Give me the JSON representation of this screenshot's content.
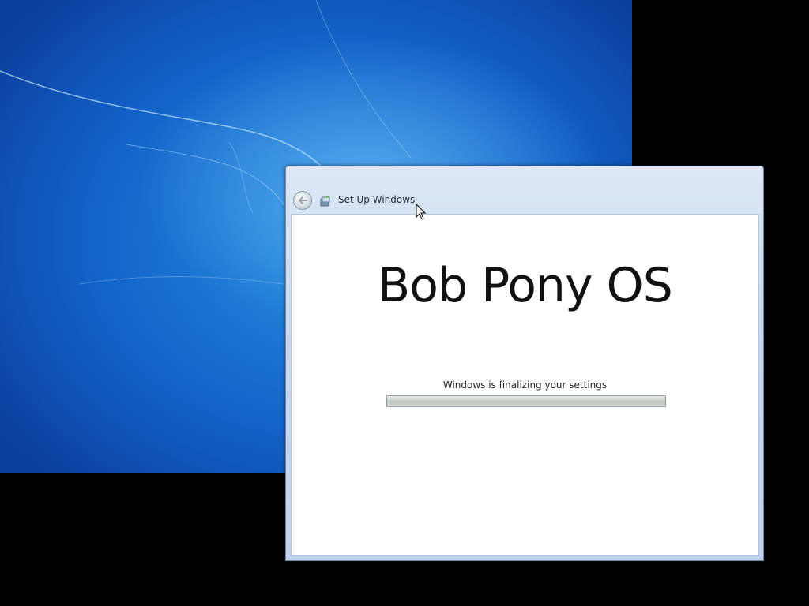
{
  "window": {
    "title": "Set Up Windows",
    "icons": {
      "back": "back-arrow-icon",
      "setup": "setup-windows-icon"
    }
  },
  "content": {
    "brand": "Bob Pony OS",
    "status_text": "Windows is finalizing your settings",
    "progress_fraction": 1.0
  },
  "desktop": {
    "background": "windows-7-blue-wallpaper"
  },
  "colors": {
    "accent": "#1262c8",
    "window_frame": "#c7d9ef"
  }
}
